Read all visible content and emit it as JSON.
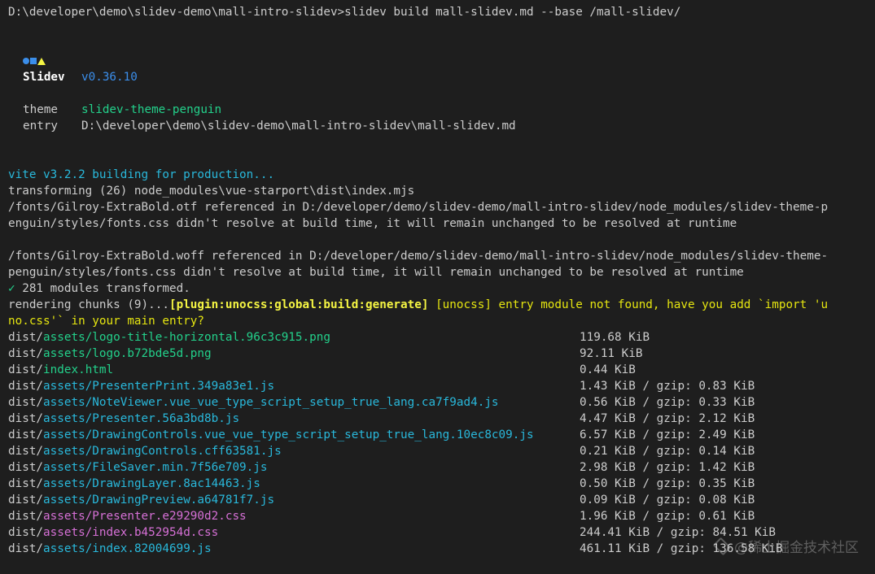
{
  "command": {
    "prompt": "D:\\developer\\demo\\slidev-demo\\mall-intro-slidev>",
    "text": "slidev build mall-slidev.md --base /mall-slidev/"
  },
  "banner": {
    "name": "Slidev",
    "version": "v0.36.10",
    "theme_label": "theme",
    "theme_value": "slidev-theme-penguin",
    "entry_label": "entry",
    "entry_value": "D:\\developer\\demo\\slidev-demo\\mall-intro-slidev\\mall-slidev.md"
  },
  "build_log": {
    "vite_line": "vite v3.2.2 building for production...",
    "transforming_line": "transforming (26) node_modules\\vue-starport\\dist\\index.mjs",
    "otf_warning_1": "/fonts/Gilroy-ExtraBold.otf referenced in D:/developer/demo/slidev-demo/mall-intro-slidev/node_modules/slidev-theme-p",
    "otf_warning_2": "enguin/styles/fonts.css didn't resolve at build time, it will remain unchanged to be resolved at runtime",
    "woff_warning_1": "/fonts/Gilroy-ExtraBold.woff referenced in D:/developer/demo/slidev-demo/mall-intro-slidev/node_modules/slidev-theme-",
    "woff_warning_2": "penguin/styles/fonts.css didn't resolve at build time, it will remain unchanged to be resolved at runtime",
    "check_mark": "✓",
    "modules_transformed": " 281 modules transformed.",
    "rendering_prefix": "rendering chunks (9)...",
    "plugin_tag": "[plugin:unocss:global:build:generate]",
    "unocss_msg_1": " [unocss] entry module not found, have you add `import 'u",
    "unocss_msg_2": "no.css'` in your main entry?"
  },
  "files": [
    {
      "dir": "dist/",
      "name": "assets/logo-title-horizontal.96c3c915.png",
      "kind": "asset",
      "size": "119.68 KiB"
    },
    {
      "dir": "dist/",
      "name": "assets/logo.b72bde5d.png",
      "kind": "asset",
      "size": "92.11 KiB"
    },
    {
      "dir": "dist/",
      "name": "index.html",
      "kind": "asset",
      "size": "0.44 KiB"
    },
    {
      "dir": "dist/",
      "name": "assets/PresenterPrint.349a83e1.js",
      "kind": "js",
      "size": "1.43 KiB / gzip: 0.83 KiB"
    },
    {
      "dir": "dist/",
      "name": "assets/NoteViewer.vue_vue_type_script_setup_true_lang.ca7f9ad4.js",
      "kind": "js",
      "size": "0.56 KiB / gzip: 0.33 KiB"
    },
    {
      "dir": "dist/",
      "name": "assets/Presenter.56a3bd8b.js",
      "kind": "js",
      "size": "4.47 KiB / gzip: 2.12 KiB"
    },
    {
      "dir": "dist/",
      "name": "assets/DrawingControls.vue_vue_type_script_setup_true_lang.10ec8c09.js",
      "kind": "js",
      "size": "6.57 KiB / gzip: 2.49 KiB"
    },
    {
      "dir": "dist/",
      "name": "assets/DrawingControls.cff63581.js",
      "kind": "js",
      "size": "0.21 KiB / gzip: 0.14 KiB"
    },
    {
      "dir": "dist/",
      "name": "assets/FileSaver.min.7f56e709.js",
      "kind": "js",
      "size": "2.98 KiB / gzip: 1.42 KiB"
    },
    {
      "dir": "dist/",
      "name": "assets/DrawingLayer.8ac14463.js",
      "kind": "js",
      "size": "0.50 KiB / gzip: 0.35 KiB"
    },
    {
      "dir": "dist/",
      "name": "assets/DrawingPreview.a64781f7.js",
      "kind": "js",
      "size": "0.09 KiB / gzip: 0.08 KiB"
    },
    {
      "dir": "dist/",
      "name": "assets/Presenter.e29290d2.css",
      "kind": "css",
      "size": "1.96 KiB / gzip: 0.61 KiB"
    },
    {
      "dir": "dist/",
      "name": "assets/index.b452954d.css",
      "kind": "css",
      "size": "244.41 KiB / gzip: 84.51 KiB"
    },
    {
      "dir": "dist/",
      "name": "assets/index.82004699.js",
      "kind": "js",
      "size": "461.11 KiB / gzip: 136.58 KiB"
    }
  ],
  "watermark": {
    "text": "@稀土掘金技术社区"
  },
  "colors": {
    "background": "#1e1e1e",
    "foreground": "#cccccc",
    "green": "#23d18b",
    "blue": "#3b8eea",
    "cyan": "#29b8db",
    "yellow": "#f5f543",
    "magenta": "#d670d6"
  }
}
